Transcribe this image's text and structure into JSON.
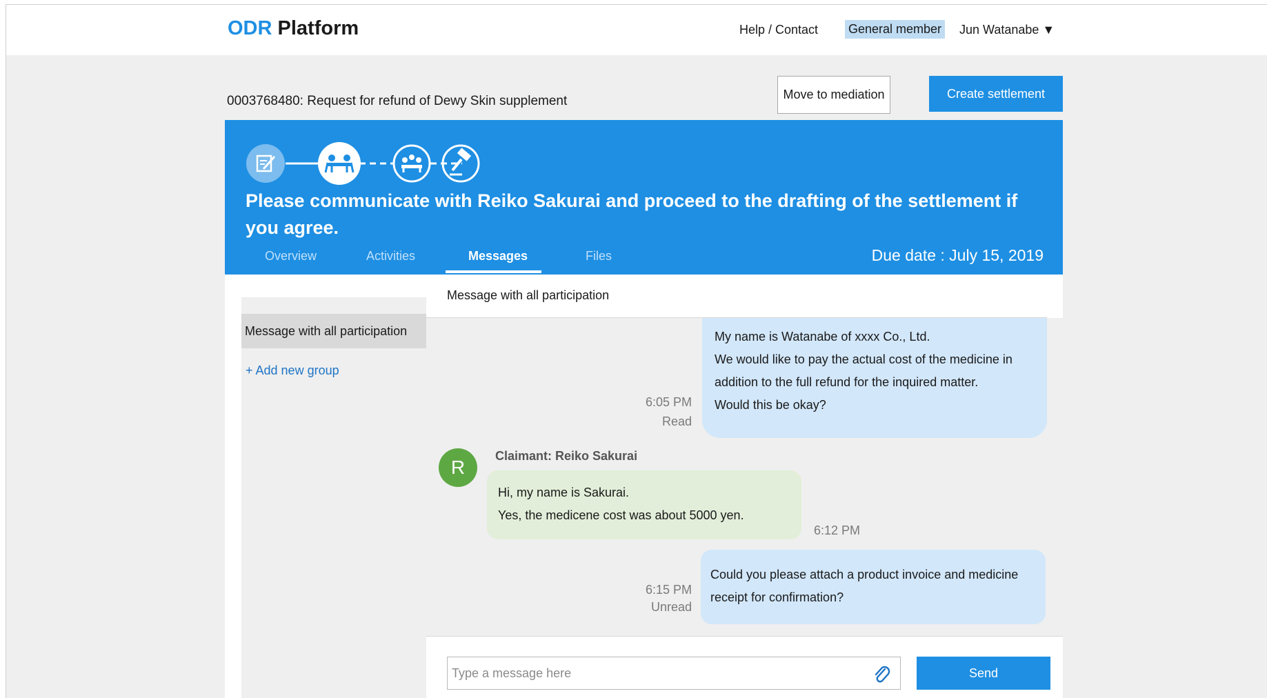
{
  "header": {
    "logo_accent": "ODR",
    "logo_rest": "Platform",
    "help_link": "Help / Contact",
    "role_badge": "General member",
    "user_name": "Jun Watanabe ▼"
  },
  "case": {
    "title": "0003768480: Request for refund of Dewy Skin supplement",
    "move_button": "Move to mediation",
    "create_button": "Create settlement"
  },
  "banner": {
    "message": "Please communicate with Reiko Sakurai and proceed to the drafting of the settlement if you agree.",
    "tabs": [
      "Overview",
      "Activities",
      "Messages",
      "Files"
    ],
    "due_date": "Due date : July 15, 2019",
    "steps": [
      "edit-document-icon",
      "meeting-icon",
      "group-discussion-icon",
      "gavel-icon"
    ]
  },
  "sidebar": {
    "active_group": "Message with all participation",
    "add_group": "+ Add new group"
  },
  "chat": {
    "header": "Message with all participation",
    "messages": [
      {
        "lines": [
          "My name is Watanabe of xxxx Co., Ltd.",
          "We would like to pay the actual cost of the medicine in",
          "addition to the full refund for the inquired matter.",
          "Would this be okay?"
        ],
        "time": "6:05 PM",
        "status": "Read"
      },
      {
        "sender": "Claimant: Reiko Sakurai",
        "avatar": "R",
        "lines": [
          "Hi, my name is Sakurai.",
          "Yes, the medicene cost was about 5000 yen."
        ],
        "time": "6:12 PM"
      },
      {
        "lines": [
          "Could you please attach a product invoice and medicine",
          "receipt for confirmation?"
        ],
        "time": "6:15 PM",
        "status": "Unread"
      }
    ]
  },
  "composer": {
    "placeholder": "Type a message here",
    "send": "Send"
  },
  "colors": {
    "primary": "#1e8fe3",
    "outgoing_bubble": "#d2e7fa",
    "incoming_bubble": "#e2eed9",
    "avatar": "#5ea844"
  }
}
